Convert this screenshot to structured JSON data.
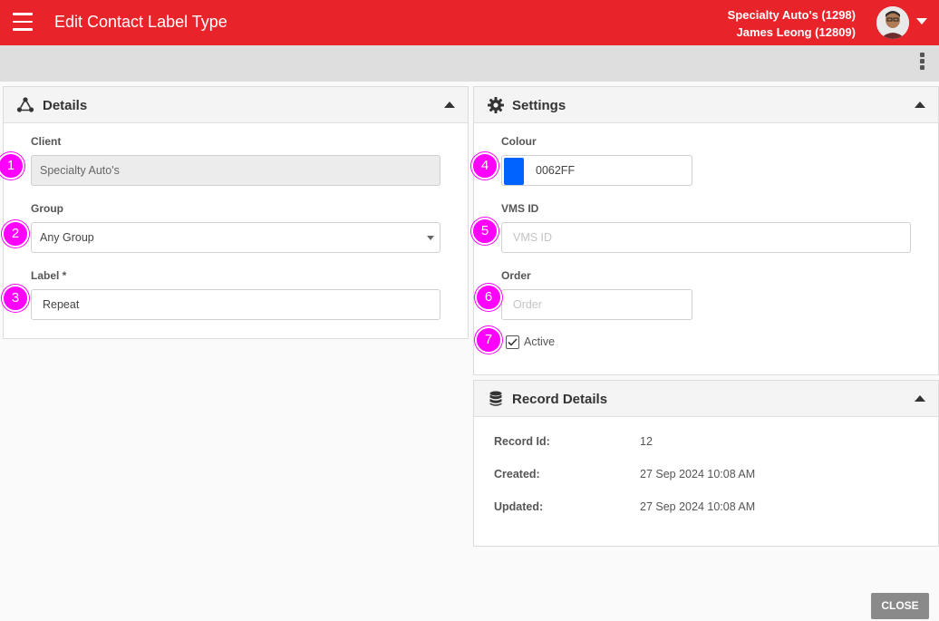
{
  "header": {
    "title": "Edit Contact Label Type",
    "account_line": "Specialty Auto's (1298)",
    "user_line": "James Leong (12809)"
  },
  "details_panel": {
    "title": "Details",
    "client": {
      "label": "Client",
      "value": "Specialty Auto's"
    },
    "group": {
      "label": "Group",
      "value": "Any Group"
    },
    "label_field": {
      "label": "Label *",
      "value": "Repeat"
    }
  },
  "settings_panel": {
    "title": "Settings",
    "colour": {
      "label": "Colour",
      "value": "0062FF",
      "swatch": "#0062ff"
    },
    "vms_id": {
      "label": "VMS ID",
      "placeholder": "VMS ID"
    },
    "order": {
      "label": "Order",
      "placeholder": "Order"
    },
    "active": {
      "label": "Active",
      "checked": true
    }
  },
  "record_panel": {
    "title": "Record Details",
    "rows": [
      {
        "label": "Record Id:",
        "value": "12"
      },
      {
        "label": "Created:",
        "value": "27 Sep 2024 10:08 AM"
      },
      {
        "label": "Updated:",
        "value": "27 Sep 2024 10:08 AM"
      }
    ]
  },
  "markers": [
    "1",
    "2",
    "3",
    "4",
    "5",
    "6",
    "7"
  ],
  "footer": {
    "close_label": "CLOSE"
  },
  "colors": {
    "brand": "#e8232a",
    "marker": "#ff00ff"
  }
}
